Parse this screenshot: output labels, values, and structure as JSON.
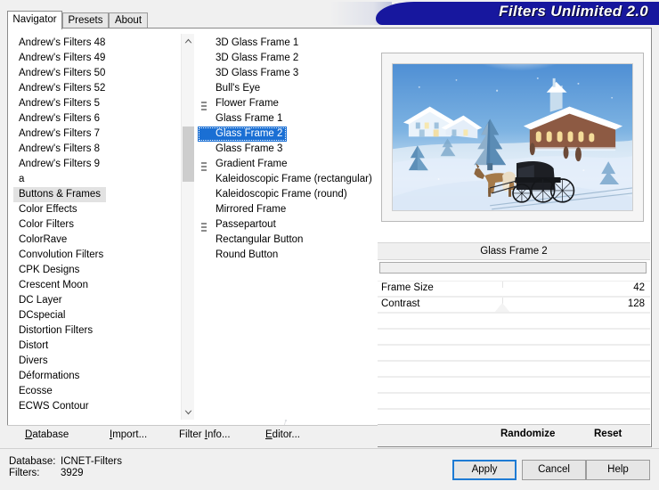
{
  "window": {
    "title": "Filters Unlimited 2.0"
  },
  "tabs": [
    {
      "label": "Navigator",
      "active": true
    },
    {
      "label": "Presets",
      "active": false
    },
    {
      "label": "About",
      "active": false
    }
  ],
  "categories": {
    "selected": "Buttons & Frames",
    "items": [
      "Andrew's Filters 48",
      "Andrew's Filters 49",
      "Andrew's Filters 50",
      "Andrew's Filters 52",
      "Andrew's Filters 5",
      "Andrew's Filters 6",
      "Andrew's Filters 7",
      "Andrew's Filters 8",
      "Andrew's Filters 9",
      "a",
      "Buttons & Frames",
      "Color Effects",
      "Color Filters",
      "ColorRave",
      "Convolution Filters",
      "CPK Designs",
      "Crescent Moon",
      "DC Layer",
      "DCspecial",
      "Distortion Filters",
      "Distort",
      "Divers",
      "Déformations",
      "Ecosse",
      "ECWS Contour"
    ]
  },
  "filters": {
    "selected": "Glass Frame 2",
    "items": [
      {
        "label": "3D Glass Frame 1",
        "grip": false
      },
      {
        "label": "3D Glass Frame 2",
        "grip": false
      },
      {
        "label": "3D Glass Frame 3",
        "grip": false
      },
      {
        "label": "Bull's Eye",
        "grip": false
      },
      {
        "label": "Flower Frame",
        "grip": true
      },
      {
        "label": "Glass Frame 1",
        "grip": false
      },
      {
        "label": "Glass Frame 2",
        "grip": false
      },
      {
        "label": "Glass Frame 3",
        "grip": false
      },
      {
        "label": "Gradient Frame",
        "grip": true
      },
      {
        "label": "Kaleidoscopic Frame (rectangular)",
        "grip": false
      },
      {
        "label": "Kaleidoscopic Frame (round)",
        "grip": false
      },
      {
        "label": "Mirrored Frame",
        "grip": false
      },
      {
        "label": "Passepartout",
        "grip": true
      },
      {
        "label": "Rectangular Button",
        "grip": false
      },
      {
        "label": "Round Button",
        "grip": false
      }
    ]
  },
  "link_bar": {
    "database": "Database",
    "database_accel": "D",
    "import": "Import...",
    "import_accel": "I",
    "filter_info": "Filter Info...",
    "filter_info_accel": "I",
    "editor": "Editor...",
    "editor_accel": "E"
  },
  "preview": {
    "image_name": "winter-village-sleigh-preview"
  },
  "parameters": {
    "filter_name": "Glass Frame 2",
    "rows": [
      {
        "label": "Frame Size",
        "value": "42",
        "thumb_pct": 46
      },
      {
        "label": "Contrast",
        "value": "128",
        "thumb_pct": 46
      },
      {
        "label": "",
        "value": "",
        "thumb_pct": null
      },
      {
        "label": "",
        "value": "",
        "thumb_pct": null
      },
      {
        "label": "",
        "value": "",
        "thumb_pct": null
      },
      {
        "label": "",
        "value": "",
        "thumb_pct": null
      },
      {
        "label": "",
        "value": "",
        "thumb_pct": null
      },
      {
        "label": "",
        "value": "",
        "thumb_pct": null
      }
    ]
  },
  "right_actions": {
    "randomize": "Randomize",
    "reset": "Reset"
  },
  "status": {
    "database_key": "Database:",
    "database_value": "ICNET-Filters",
    "filters_key": "Filters:",
    "filters_value": "3929"
  },
  "footer_buttons": {
    "apply": "Apply",
    "cancel": "Cancel",
    "help": "Help"
  },
  "colors": {
    "banner": "#17179e",
    "selection": "#1a6fd4",
    "focus_border": "#1e7bd4",
    "category_selection": "#e2e2e2"
  }
}
